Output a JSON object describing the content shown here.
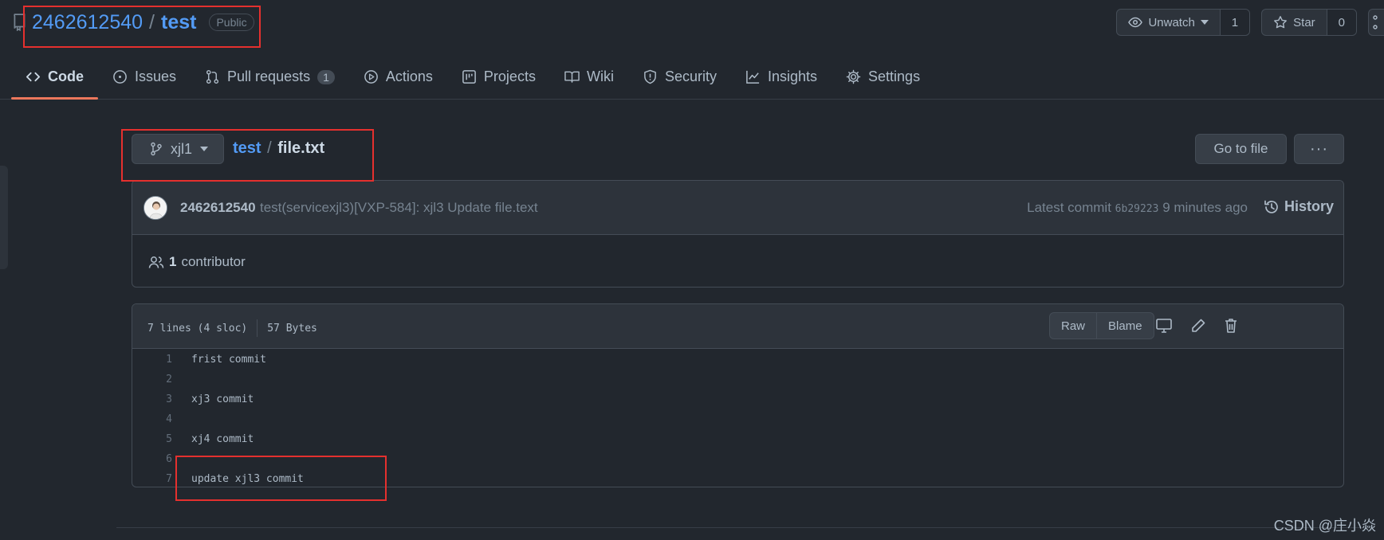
{
  "repo": {
    "owner": "2462612540",
    "separator": "/",
    "name": "test",
    "visibility": "Public"
  },
  "header_actions": {
    "watch_label": "Unwatch",
    "watch_count": "1",
    "star_label": "Star",
    "star_count": "0"
  },
  "tabs": [
    {
      "label": "Code",
      "icon": "code-icon",
      "selected": true
    },
    {
      "label": "Issues",
      "icon": "issue-icon"
    },
    {
      "label": "Pull requests",
      "icon": "pull-request-icon",
      "count": "1"
    },
    {
      "label": "Actions",
      "icon": "play-icon"
    },
    {
      "label": "Projects",
      "icon": "project-icon"
    },
    {
      "label": "Wiki",
      "icon": "book-icon"
    },
    {
      "label": "Security",
      "icon": "shield-icon"
    },
    {
      "label": "Insights",
      "icon": "graph-icon"
    },
    {
      "label": "Settings",
      "icon": "gear-icon"
    }
  ],
  "breadcrumb": {
    "branch": "xjl1",
    "dir": "test",
    "separator": "/",
    "file": "file.txt",
    "goto_label": "Go to file",
    "more_label": "···"
  },
  "commit": {
    "author": "2462612540",
    "message": "test(servicexjl3)[VXP-584]: xjl3 Update file.text",
    "latest_label": "Latest commit",
    "sha": "6b29223",
    "time": "9 minutes ago",
    "history_label": "History",
    "contributor_count": "1",
    "contributor_label": "contributor"
  },
  "file": {
    "lines_info": "7 lines (4 sloc)",
    "size_info": "57 Bytes",
    "raw_label": "Raw",
    "blame_label": "Blame",
    "lines": [
      {
        "n": "1",
        "text": "frist commit"
      },
      {
        "n": "2",
        "text": ""
      },
      {
        "n": "3",
        "text": "xj3 commit"
      },
      {
        "n": "4",
        "text": ""
      },
      {
        "n": "5",
        "text": "xj4 commit"
      },
      {
        "n": "6",
        "text": ""
      },
      {
        "n": "7",
        "text": "update xjl3 commit"
      }
    ]
  },
  "watermark": "CSDN @庄小焱",
  "colors": {
    "background": "#22272e",
    "link": "#539bf5",
    "selected_tab_underline": "#ec775c",
    "annotation_box": "#e5302e"
  }
}
